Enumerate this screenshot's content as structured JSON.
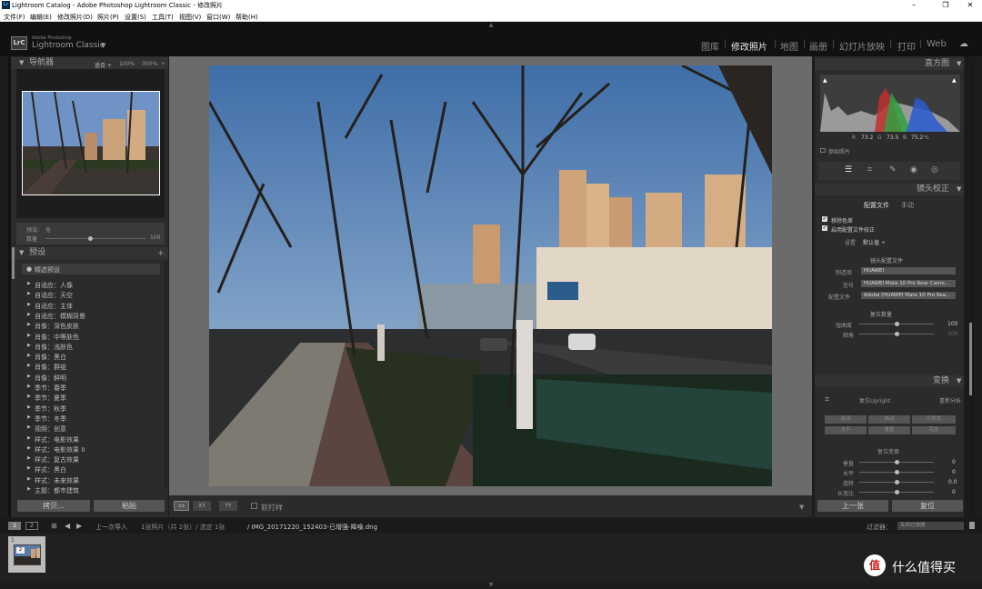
{
  "window": {
    "title": "Lightroom Catalog - Adobe Photoshop Lightroom Classic - 修改照片",
    "app_icon": "Lr",
    "controls": [
      "–",
      "❐",
      "✕"
    ]
  },
  "menu": [
    "文件(F)",
    "编辑(E)",
    "修改照片(D)",
    "照片(P)",
    "设置(S)",
    "工具(T)",
    "视图(V)",
    "窗口(W)",
    "帮助(H)"
  ],
  "brand": {
    "logo": "LrC",
    "subtitle": "Adobe Photoshop",
    "name": "Lightroom Classic",
    "arrow": "▼"
  },
  "modules": [
    "图库",
    "修改照片",
    "地图",
    "画册",
    "幻灯片放映",
    "打印",
    "Web"
  ],
  "active_module": "修改照片",
  "separator": "|",
  "left": {
    "navigator": {
      "title": "导航器",
      "zoom": [
        "适合 ÷",
        "100%",
        "300%",
        "÷"
      ]
    },
    "quick": {
      "preset_label": "预设:",
      "preset_value": "无",
      "amount_label": "数量",
      "amount_value": "100"
    },
    "presets": {
      "title": "预设",
      "add": "+",
      "selected": "精选预设",
      "items": [
        "自适应：人像",
        "自适应：天空",
        "自适应：主体",
        "自适应：模糊背景",
        "肖像：深色皮肤",
        "肖像：中等肤色",
        "肖像：浅肤色",
        "肖像：黑白",
        "肖像：群组",
        "肖像：鲜明",
        "季节：春季",
        "季节：夏季",
        "季节：秋季",
        "季节：冬季",
        "视频：创意",
        "样式：电影效果",
        "样式：电影效果 II",
        "样式：复古效果",
        "样式：黑白",
        "样式：未来效果",
        "主题：都市建筑"
      ]
    },
    "copy": "拷贝...",
    "paste": "粘贴"
  },
  "center": {
    "toolbar": {
      "soft_proof": "软打样",
      "view_icon": "▭",
      "xy": "XY",
      "yy": "YY"
    }
  },
  "right": {
    "histogram": {
      "title": "直方图",
      "readout": {
        "r_label": "R",
        "r": "73.2",
        "g_label": "G",
        "g": "73.5",
        "b_label": "B",
        "b": "75.2",
        "unit": "%"
      },
      "original": "原始照片"
    },
    "lens": {
      "title": "镜头校正",
      "tab_profile": "配置文件",
      "tab_manual": "手动",
      "remove_ca": "移除色差",
      "enable_profile": "启用配置文件校正",
      "setup_label": "设置",
      "setup_value": "默认值 ÷",
      "section": "镜头配置文件",
      "make_label": "制造商",
      "make": "HUAWEI",
      "model_label": "型号",
      "model": "HUAWEI Mate 10 Pro Rear Came...",
      "profile_label": "配置文件",
      "profile": "Adobe (HUAWEI Mate 10 Pro Rea...",
      "amount_section": "复位数量",
      "distortion_label": "扭曲度",
      "distortion": "100",
      "vignette_label": "暗角",
      "vignette": "100"
    },
    "transform": {
      "title": "变换",
      "upright": "复位Upright",
      "reanalyze": "重新分析",
      "buttons": [
        "关闭",
        "自动",
        "引导式",
        "水平",
        "垂直",
        "完全"
      ],
      "manual": "复位变换",
      "vertical_label": "垂直",
      "vertical": "0",
      "horizontal_label": "水平",
      "horizontal": "0",
      "rotate_label": "旋转",
      "rotate": "0.0",
      "aspect_label": "长宽比",
      "aspect": "0"
    },
    "prev": "上一张",
    "reset": "复位"
  },
  "filmstrip": {
    "screen1": "1",
    "screen2": "2",
    "source": "上一次导入",
    "count": "1张照片（共 2张）/ 选定 1张",
    "file": "/ IMG_20171220_152403-已增强-降噪.dng",
    "filter_label": "过滤器：",
    "filter_value": "关闭过滤器",
    "thumb_badge": "2",
    "thumb_num": "1"
  },
  "watermark": {
    "logo": "值",
    "text": "什么值得买"
  },
  "colors": {
    "bg": "#1d1d1d",
    "panel": "#2b2b2b",
    "accent": "#eeeeee"
  }
}
